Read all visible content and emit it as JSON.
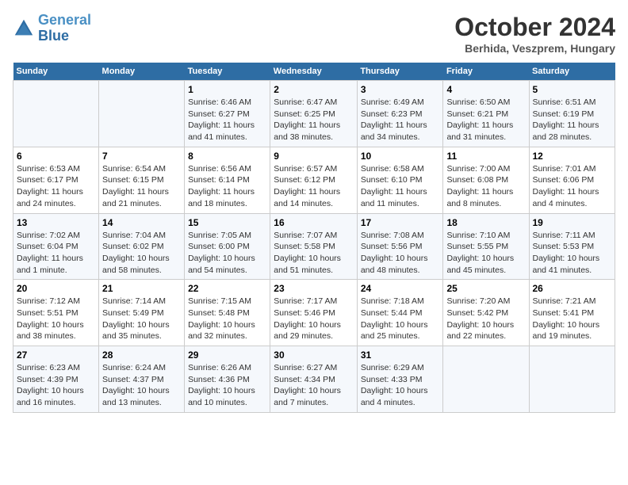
{
  "header": {
    "logo_line1": "General",
    "logo_line2": "Blue",
    "month": "October 2024",
    "location": "Berhida, Veszprem, Hungary"
  },
  "days_of_week": [
    "Sunday",
    "Monday",
    "Tuesday",
    "Wednesday",
    "Thursday",
    "Friday",
    "Saturday"
  ],
  "weeks": [
    [
      {
        "day": "",
        "sunrise": "",
        "sunset": "",
        "daylight": ""
      },
      {
        "day": "",
        "sunrise": "",
        "sunset": "",
        "daylight": ""
      },
      {
        "day": "1",
        "sunrise": "Sunrise: 6:46 AM",
        "sunset": "Sunset: 6:27 PM",
        "daylight": "Daylight: 11 hours and 41 minutes."
      },
      {
        "day": "2",
        "sunrise": "Sunrise: 6:47 AM",
        "sunset": "Sunset: 6:25 PM",
        "daylight": "Daylight: 11 hours and 38 minutes."
      },
      {
        "day": "3",
        "sunrise": "Sunrise: 6:49 AM",
        "sunset": "Sunset: 6:23 PM",
        "daylight": "Daylight: 11 hours and 34 minutes."
      },
      {
        "day": "4",
        "sunrise": "Sunrise: 6:50 AM",
        "sunset": "Sunset: 6:21 PM",
        "daylight": "Daylight: 11 hours and 31 minutes."
      },
      {
        "day": "5",
        "sunrise": "Sunrise: 6:51 AM",
        "sunset": "Sunset: 6:19 PM",
        "daylight": "Daylight: 11 hours and 28 minutes."
      }
    ],
    [
      {
        "day": "6",
        "sunrise": "Sunrise: 6:53 AM",
        "sunset": "Sunset: 6:17 PM",
        "daylight": "Daylight: 11 hours and 24 minutes."
      },
      {
        "day": "7",
        "sunrise": "Sunrise: 6:54 AM",
        "sunset": "Sunset: 6:15 PM",
        "daylight": "Daylight: 11 hours and 21 minutes."
      },
      {
        "day": "8",
        "sunrise": "Sunrise: 6:56 AM",
        "sunset": "Sunset: 6:14 PM",
        "daylight": "Daylight: 11 hours and 18 minutes."
      },
      {
        "day": "9",
        "sunrise": "Sunrise: 6:57 AM",
        "sunset": "Sunset: 6:12 PM",
        "daylight": "Daylight: 11 hours and 14 minutes."
      },
      {
        "day": "10",
        "sunrise": "Sunrise: 6:58 AM",
        "sunset": "Sunset: 6:10 PM",
        "daylight": "Daylight: 11 hours and 11 minutes."
      },
      {
        "day": "11",
        "sunrise": "Sunrise: 7:00 AM",
        "sunset": "Sunset: 6:08 PM",
        "daylight": "Daylight: 11 hours and 8 minutes."
      },
      {
        "day": "12",
        "sunrise": "Sunrise: 7:01 AM",
        "sunset": "Sunset: 6:06 PM",
        "daylight": "Daylight: 11 hours and 4 minutes."
      }
    ],
    [
      {
        "day": "13",
        "sunrise": "Sunrise: 7:02 AM",
        "sunset": "Sunset: 6:04 PM",
        "daylight": "Daylight: 11 hours and 1 minute."
      },
      {
        "day": "14",
        "sunrise": "Sunrise: 7:04 AM",
        "sunset": "Sunset: 6:02 PM",
        "daylight": "Daylight: 10 hours and 58 minutes."
      },
      {
        "day": "15",
        "sunrise": "Sunrise: 7:05 AM",
        "sunset": "Sunset: 6:00 PM",
        "daylight": "Daylight: 10 hours and 54 minutes."
      },
      {
        "day": "16",
        "sunrise": "Sunrise: 7:07 AM",
        "sunset": "Sunset: 5:58 PM",
        "daylight": "Daylight: 10 hours and 51 minutes."
      },
      {
        "day": "17",
        "sunrise": "Sunrise: 7:08 AM",
        "sunset": "Sunset: 5:56 PM",
        "daylight": "Daylight: 10 hours and 48 minutes."
      },
      {
        "day": "18",
        "sunrise": "Sunrise: 7:10 AM",
        "sunset": "Sunset: 5:55 PM",
        "daylight": "Daylight: 10 hours and 45 minutes."
      },
      {
        "day": "19",
        "sunrise": "Sunrise: 7:11 AM",
        "sunset": "Sunset: 5:53 PM",
        "daylight": "Daylight: 10 hours and 41 minutes."
      }
    ],
    [
      {
        "day": "20",
        "sunrise": "Sunrise: 7:12 AM",
        "sunset": "Sunset: 5:51 PM",
        "daylight": "Daylight: 10 hours and 38 minutes."
      },
      {
        "day": "21",
        "sunrise": "Sunrise: 7:14 AM",
        "sunset": "Sunset: 5:49 PM",
        "daylight": "Daylight: 10 hours and 35 minutes."
      },
      {
        "day": "22",
        "sunrise": "Sunrise: 7:15 AM",
        "sunset": "Sunset: 5:48 PM",
        "daylight": "Daylight: 10 hours and 32 minutes."
      },
      {
        "day": "23",
        "sunrise": "Sunrise: 7:17 AM",
        "sunset": "Sunset: 5:46 PM",
        "daylight": "Daylight: 10 hours and 29 minutes."
      },
      {
        "day": "24",
        "sunrise": "Sunrise: 7:18 AM",
        "sunset": "Sunset: 5:44 PM",
        "daylight": "Daylight: 10 hours and 25 minutes."
      },
      {
        "day": "25",
        "sunrise": "Sunrise: 7:20 AM",
        "sunset": "Sunset: 5:42 PM",
        "daylight": "Daylight: 10 hours and 22 minutes."
      },
      {
        "day": "26",
        "sunrise": "Sunrise: 7:21 AM",
        "sunset": "Sunset: 5:41 PM",
        "daylight": "Daylight: 10 hours and 19 minutes."
      }
    ],
    [
      {
        "day": "27",
        "sunrise": "Sunrise: 6:23 AM",
        "sunset": "Sunset: 4:39 PM",
        "daylight": "Daylight: 10 hours and 16 minutes."
      },
      {
        "day": "28",
        "sunrise": "Sunrise: 6:24 AM",
        "sunset": "Sunset: 4:37 PM",
        "daylight": "Daylight: 10 hours and 13 minutes."
      },
      {
        "day": "29",
        "sunrise": "Sunrise: 6:26 AM",
        "sunset": "Sunset: 4:36 PM",
        "daylight": "Daylight: 10 hours and 10 minutes."
      },
      {
        "day": "30",
        "sunrise": "Sunrise: 6:27 AM",
        "sunset": "Sunset: 4:34 PM",
        "daylight": "Daylight: 10 hours and 7 minutes."
      },
      {
        "day": "31",
        "sunrise": "Sunrise: 6:29 AM",
        "sunset": "Sunset: 4:33 PM",
        "daylight": "Daylight: 10 hours and 4 minutes."
      },
      {
        "day": "",
        "sunrise": "",
        "sunset": "",
        "daylight": ""
      },
      {
        "day": "",
        "sunrise": "",
        "sunset": "",
        "daylight": ""
      }
    ]
  ]
}
